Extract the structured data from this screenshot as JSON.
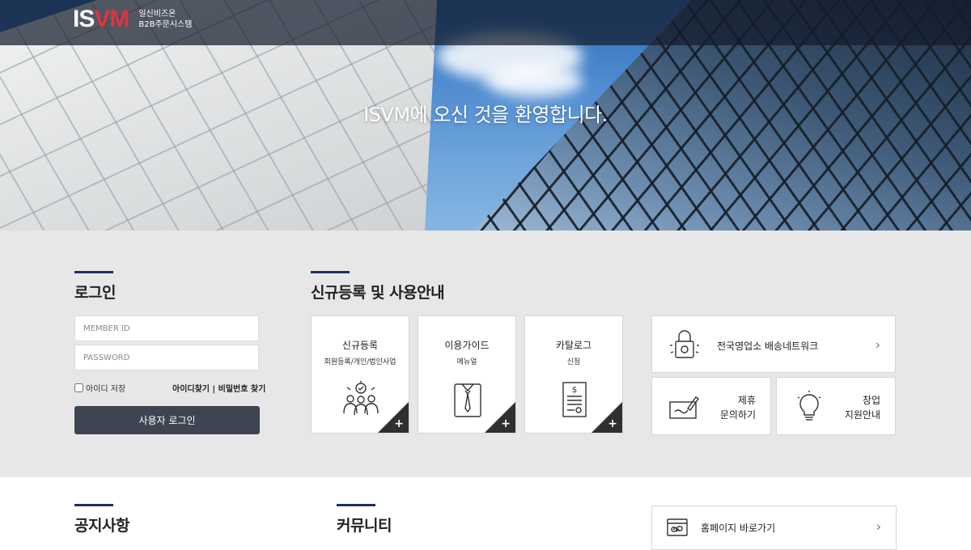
{
  "header": {
    "logo_text_1": "IS",
    "logo_text_2": "VM",
    "logo_sub_1": "일신비즈온",
    "logo_sub_2": "B2B주문시스템"
  },
  "hero": {
    "title": "ISVM에 오신 것을 환영합니다."
  },
  "login": {
    "title": "로그인",
    "id_placeholder": "MEMBER ID",
    "pw_placeholder": "PASSWORD",
    "save_id_label": "아이디 저장",
    "find_id": "아이디찾기",
    "divider": " | ",
    "find_pw": "비밀번호 찾기",
    "submit_label": "사용자 로그인"
  },
  "guide": {
    "title": "신규등록 및 사용안내",
    "cards": [
      {
        "title": "신규등록",
        "subtitle": "회원등록/개인/법인사업",
        "icon": "people-check-icon"
      },
      {
        "title": "이용가이드",
        "subtitle": "메뉴얼",
        "icon": "shirt-tie-icon"
      },
      {
        "title": "카탈로그",
        "subtitle": "신청",
        "icon": "document-dollar-icon"
      }
    ],
    "plus": "+"
  },
  "links": {
    "network_label": "전국영업소 배송네트워크",
    "partner_label_1": "제휴",
    "partner_label_2": "문의하기",
    "startup_label_1": "창업",
    "startup_label_2": "지원안내",
    "homepage_label": "홈페이지 바로가기",
    "chevron": "›"
  },
  "bottom": {
    "notice_title": "공지사항",
    "community_title": "커뮤니티"
  }
}
